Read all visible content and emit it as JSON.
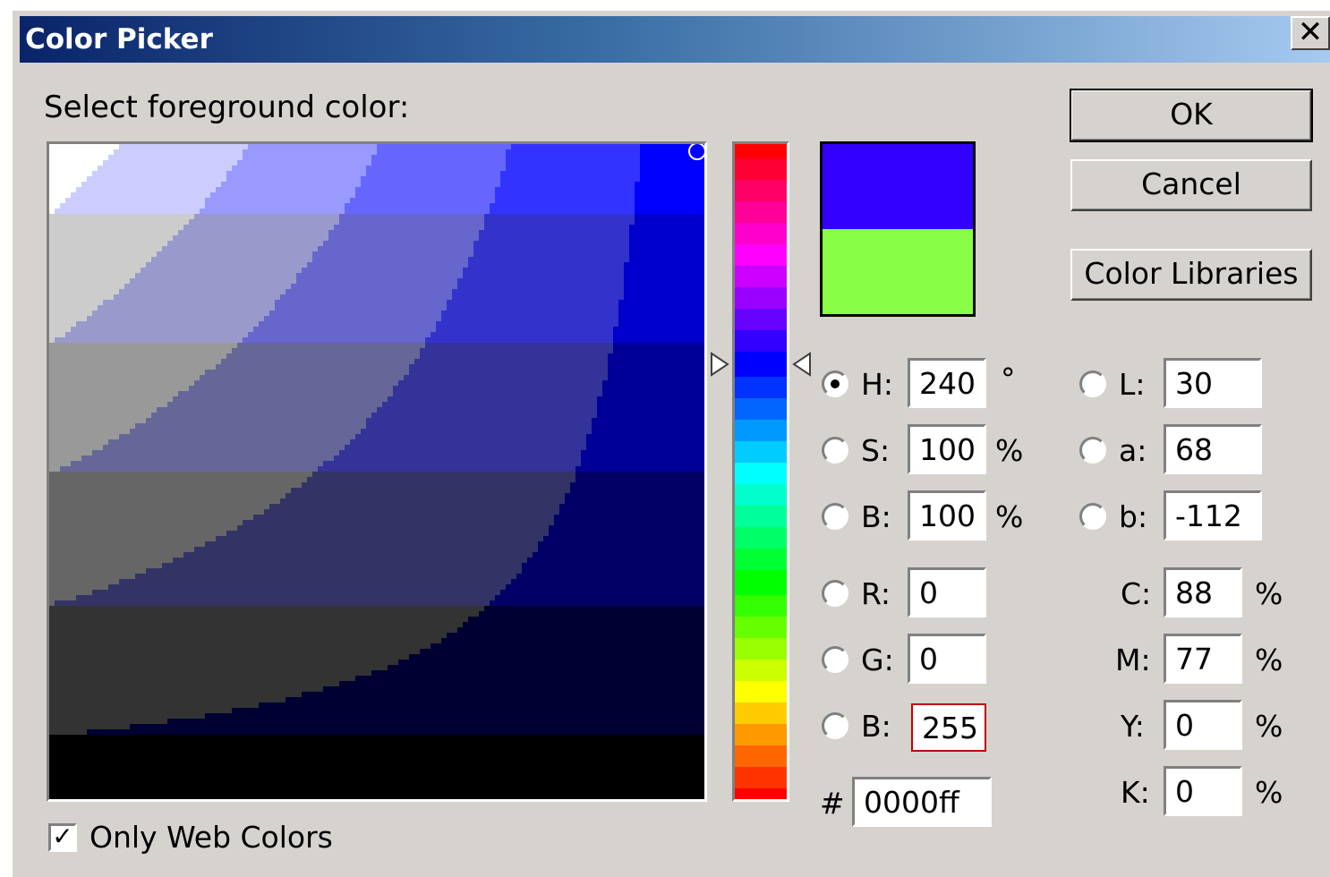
{
  "window": {
    "title": "Color Picker",
    "close_glyph": "✕"
  },
  "prompt": "Select foreground color:",
  "buttons": {
    "ok": "OK",
    "cancel": "Cancel",
    "libraries": "Color Libraries"
  },
  "swatch": {
    "new_color": "#3300ff",
    "current_color": "#88ff44"
  },
  "hsb": {
    "h": {
      "label": "H:",
      "value": "240",
      "unit": "°",
      "selected": true
    },
    "s": {
      "label": "S:",
      "value": "100",
      "unit": "%"
    },
    "b": {
      "label": "B:",
      "value": "100",
      "unit": "%"
    }
  },
  "rgb": {
    "r": {
      "label": "R:",
      "value": "0"
    },
    "g": {
      "label": "G:",
      "value": "0"
    },
    "b": {
      "label": "B:",
      "value": "255"
    }
  },
  "lab": {
    "l": {
      "label": "L:",
      "value": "30"
    },
    "a": {
      "label": "a:",
      "value": "68"
    },
    "b": {
      "label": "b:",
      "value": "-112"
    }
  },
  "cmyk": {
    "c": {
      "label": "C:",
      "value": "88",
      "unit": "%"
    },
    "m": {
      "label": "M:",
      "value": "77",
      "unit": "%"
    },
    "y": {
      "label": "Y:",
      "value": "0",
      "unit": "%"
    },
    "k": {
      "label": "K:",
      "value": "0",
      "unit": "%"
    }
  },
  "hex": {
    "label": "#",
    "value": "0000ff"
  },
  "web_colors": {
    "label": "Only Web Colors",
    "checked": true,
    "check_glyph": "✓"
  },
  "hue_slider": {
    "hue_degrees": 240
  }
}
